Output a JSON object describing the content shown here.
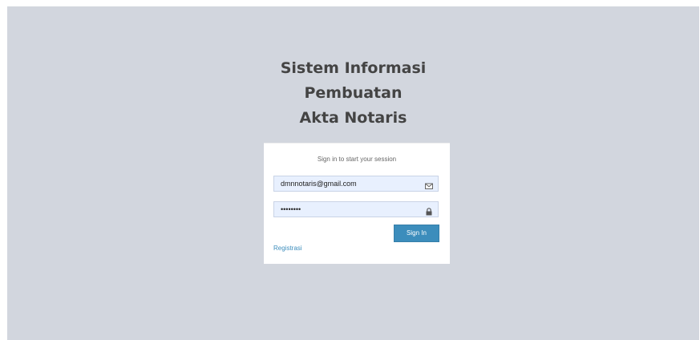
{
  "title_lines": [
    "Sistem Informasi",
    "Pembuatan",
    "Akta Notaris"
  ],
  "login": {
    "message": "Sign in to start your session",
    "email_value": "dmnnotaris@gmail.com",
    "password_value": "••••••••",
    "signin_label": "Sign In",
    "register_label": "Registrasi"
  },
  "icons": {
    "email": "envelope-icon",
    "password": "lock-icon"
  },
  "colors": {
    "background": "#d2d6de",
    "primary": "#3c8dbc",
    "field_autofill": "#e8f0fe"
  }
}
